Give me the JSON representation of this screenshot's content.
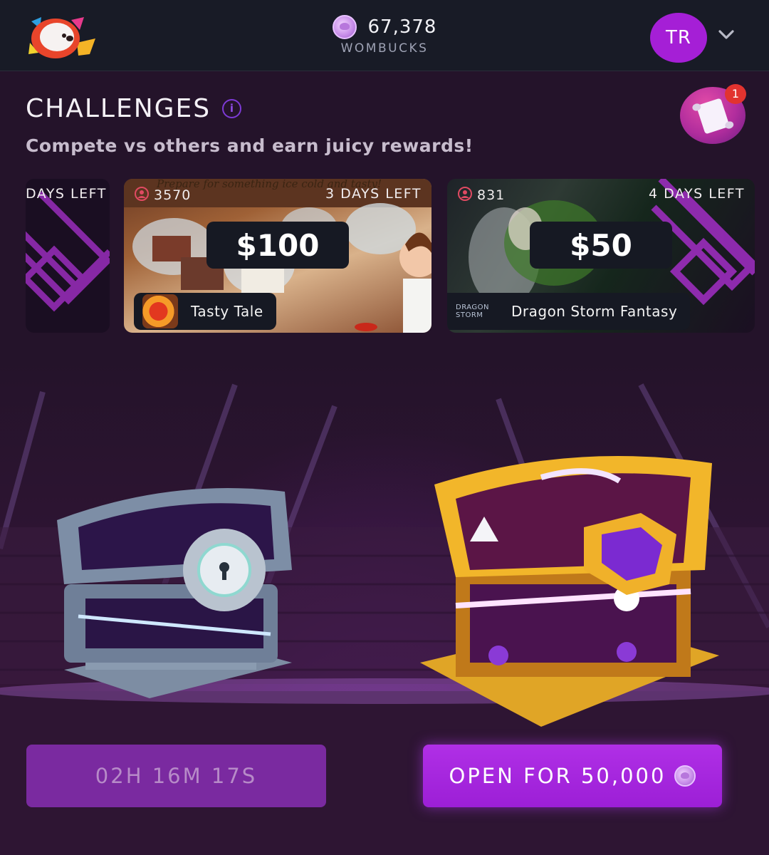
{
  "header": {
    "balance_value": "67,378",
    "balance_label": "WOMBUCKS",
    "avatar_initials": "TR"
  },
  "challenges": {
    "title": "CHALLENGES",
    "subtitle": "Compete vs others and earn juicy rewards!",
    "notification_count": "1",
    "cards": [
      {
        "days_left": "DAYS LEFT"
      },
      {
        "players": "3570",
        "days_left": "3 DAYS LEFT",
        "prize": "$100",
        "game": "Tasty Tale",
        "banner": "Prepare for something ice cold and tasty!"
      },
      {
        "players": "831",
        "days_left": "4 DAYS LEFT",
        "prize": "$50",
        "game": "Dragon Storm Fantasy",
        "game_logo_text": "DRAGON STORM"
      }
    ]
  },
  "chests": {
    "free_chest_timer": "02H 16M 17S",
    "open_label": "OPEN FOR 50,000"
  },
  "colors": {
    "accent_purple": "#a51fd6",
    "background": "#24132a",
    "topbar": "#181b26"
  }
}
